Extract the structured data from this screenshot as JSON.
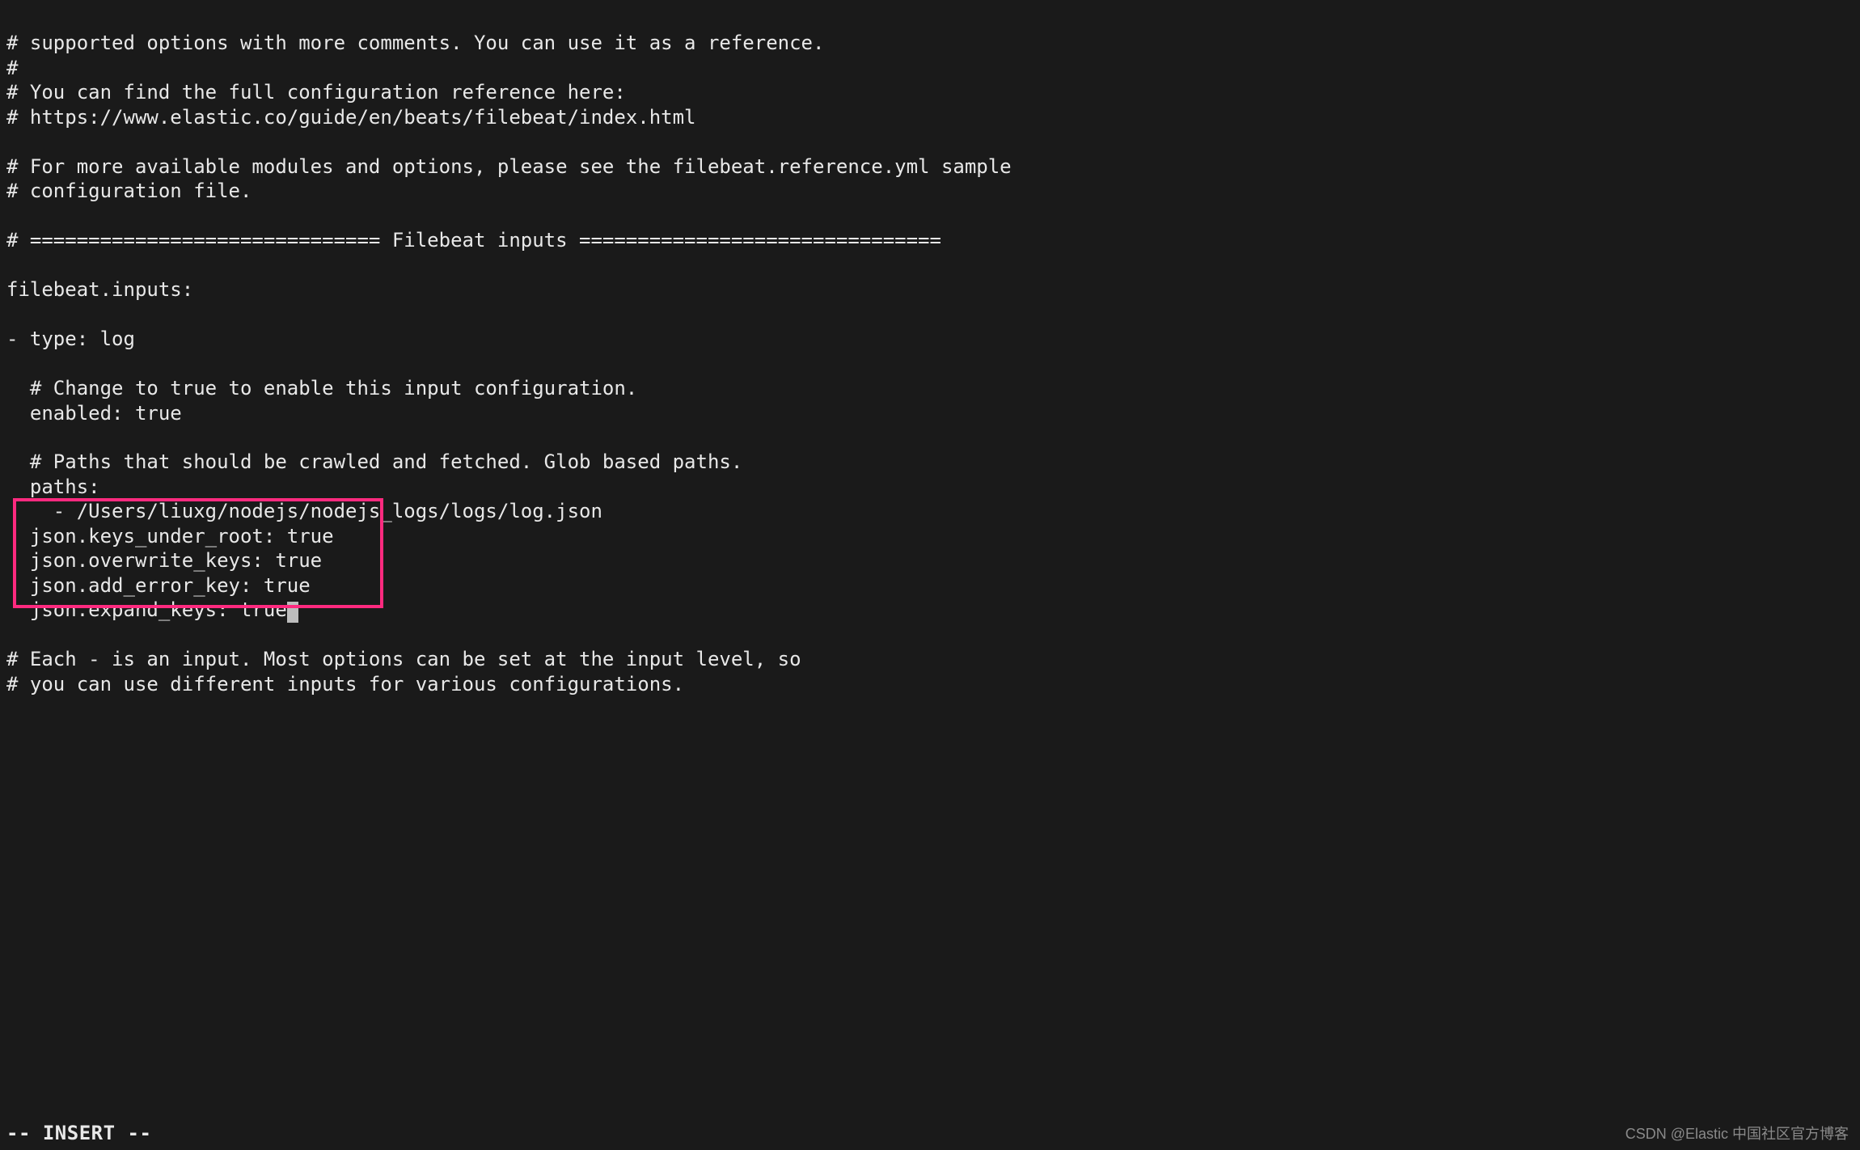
{
  "lines": {
    "l01": "# supported options with more comments. You can use it as a reference.",
    "l02": "#",
    "l03": "# You can find the full configuration reference here:",
    "l04": "# https://www.elastic.co/guide/en/beats/filebeat/index.html",
    "l05": "",
    "l06": "# For more available modules and options, please see the filebeat.reference.yml sample",
    "l07": "# configuration file.",
    "l08": "",
    "l09": "# ============================== Filebeat inputs ===============================",
    "l10": "",
    "l11": "filebeat.inputs:",
    "l12": "",
    "l13": "- type: log",
    "l14": "",
    "l15": "  # Change to true to enable this input configuration.",
    "l16": "  enabled: true",
    "l17": "",
    "l18": "  # Paths that should be crawled and fetched. Glob based paths.",
    "l19": "  paths:",
    "l20": "    - /Users/liuxg/nodejs/nodejs_logs/logs/log.json",
    "l21": "  json.keys_under_root: true",
    "l22": "  json.overwrite_keys: true",
    "l23": "  json.add_error_key: true",
    "l24": "  json.expand_keys: true",
    "l25": "",
    "l26": "# Each - is an input. Most options can be set at the input level, so",
    "l27": "# you can use different inputs for various configurations."
  },
  "status": "-- INSERT --",
  "watermark": "CSDN @Elastic 中国社区官方博客"
}
